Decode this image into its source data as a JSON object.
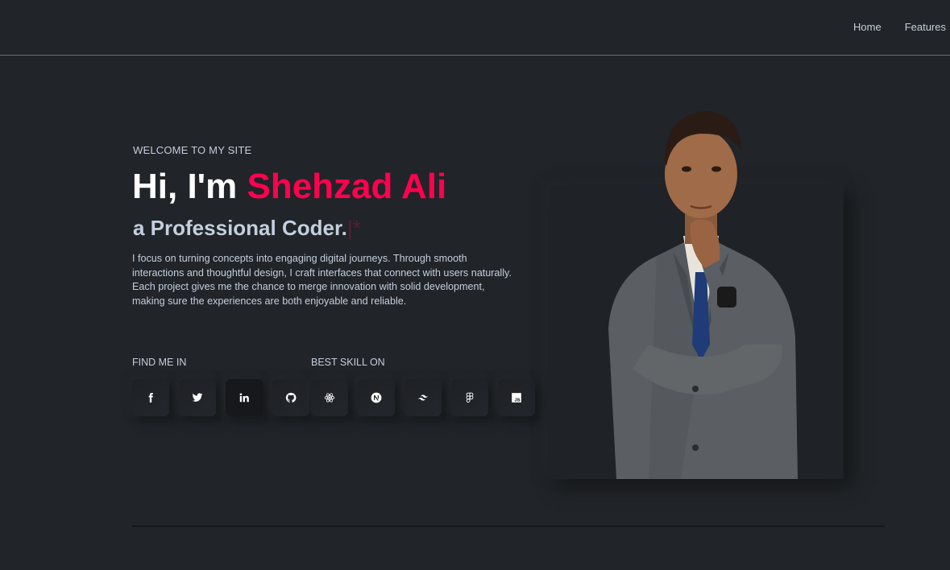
{
  "nav": {
    "items": [
      "Home",
      "Features"
    ]
  },
  "hero": {
    "welcome": "WELCOME TO MY SITE",
    "greeting": "Hi, I'm ",
    "name": "Shehzad Ali",
    "subtitle": "a Professional Coder.",
    "cursor": "|*",
    "description": "I focus on turning concepts into engaging digital journeys. Through smooth interactions and thoughtful design, I craft interfaces that connect with users naturally. Each project gives me the chance to merge innovation with solid development, making sure the experiences are both enjoyable and reliable."
  },
  "find": {
    "label": "FIND ME IN",
    "icons": [
      "facebook-icon",
      "twitter-icon",
      "linkedin-icon",
      "github-icon"
    ]
  },
  "skills": {
    "label": "BEST SKILL ON",
    "icons": [
      "react-icon",
      "nextjs-icon",
      "tailwind-icon",
      "figma-icon",
      "javascript-icon"
    ],
    "js_text": "JS"
  },
  "colors": {
    "background": "#212428",
    "accent": "#ff014f",
    "text": "#c4cfde",
    "heading": "#ffffff"
  }
}
